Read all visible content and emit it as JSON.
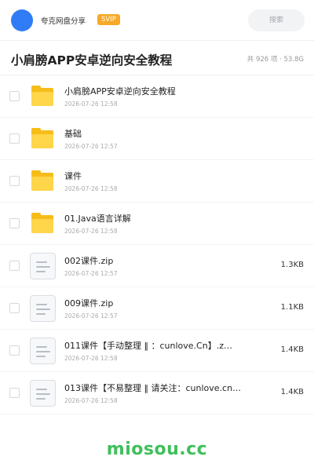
{
  "header": {
    "username": "夸克网盘分享",
    "badge": "SVIP",
    "search_placeholder": "搜索"
  },
  "folder": {
    "title": "小肩膀APP安卓逆向安全教程",
    "meta": "共 926 项 · 53.8G"
  },
  "files": [
    {
      "name": "小肩膀APP安卓逆向安全教程",
      "date": "2026-07-26 12:58",
      "size": "",
      "icon": "folder-icon"
    },
    {
      "name": "基础",
      "date": "2026-07-26 12:57",
      "size": "",
      "icon": "folder-icon"
    },
    {
      "name": "课件",
      "date": "2026-07-26 12:58",
      "size": "",
      "icon": "folder-icon"
    },
    {
      "name": "01.Java语言详解",
      "date": "2026-07-26 12:58",
      "size": "",
      "icon": "folder-icon"
    },
    {
      "name": "002课件.zip",
      "date": "2026-07-26 12:57",
      "size": "1.3KB",
      "icon": "file-icon"
    },
    {
      "name": "009课件.zip",
      "date": "2026-07-26 12:57",
      "size": "1.1KB",
      "icon": "file-icon"
    },
    {
      "name": "011课件【手动整理 ‖ ：cunlove.Cn】.z…",
      "date": "2026-07-26 12:58",
      "size": "1.4KB",
      "icon": "file-icon"
    },
    {
      "name": "013课件【不易整理 ‖ 请关注：cunlove.cn…",
      "date": "2026-07-26 12:58",
      "size": "1.4KB",
      "icon": "file-icon"
    }
  ],
  "watermark": "miosou.cc",
  "colors": {
    "accent": "#2f7cf6",
    "svip": "#f7a928",
    "folder": "#ffd54a",
    "watermark": "#3fbf5b"
  }
}
